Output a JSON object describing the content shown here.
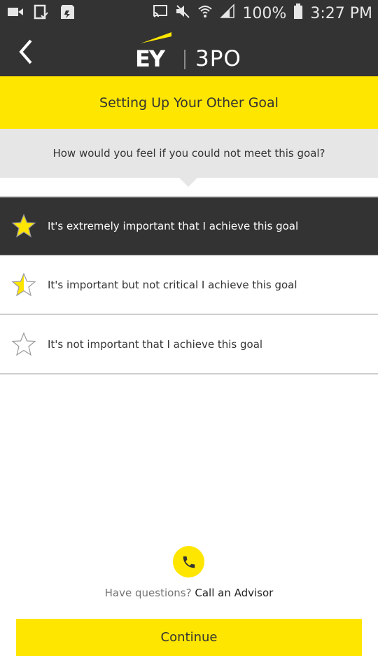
{
  "status_bar": {
    "battery": "100%",
    "time": "3:27 PM",
    "icons": [
      "video-camera-icon",
      "screen-check-icon",
      "sd-card-icon",
      "cast-icon",
      "mute-icon",
      "wifi-icon",
      "signal-icon",
      "battery-icon"
    ]
  },
  "header": {
    "back_icon": "chevron-left-icon",
    "logo_ey": "EY",
    "logo_product": "3PO"
  },
  "page": {
    "title": "Setting Up Your Other Goal",
    "question": "How would you feel if you could not meet this goal?"
  },
  "options": [
    {
      "label": "It's extremely important that I achieve this goal",
      "icon": "full-star-icon",
      "selected": true
    },
    {
      "label": "It's important but not critical I achieve this goal",
      "icon": "half-star-icon",
      "selected": false
    },
    {
      "label": "It's not important that I achieve this goal",
      "icon": "empty-star-icon",
      "selected": false
    }
  ],
  "advisor": {
    "icon": "phone-icon",
    "prefix": "Have questions?",
    "link": "Call an Advisor"
  },
  "actions": {
    "continue_label": "Continue"
  },
  "colors": {
    "brand_yellow": "#ffe600",
    "dark": "#333333",
    "question_bg": "#e6e6e6"
  }
}
